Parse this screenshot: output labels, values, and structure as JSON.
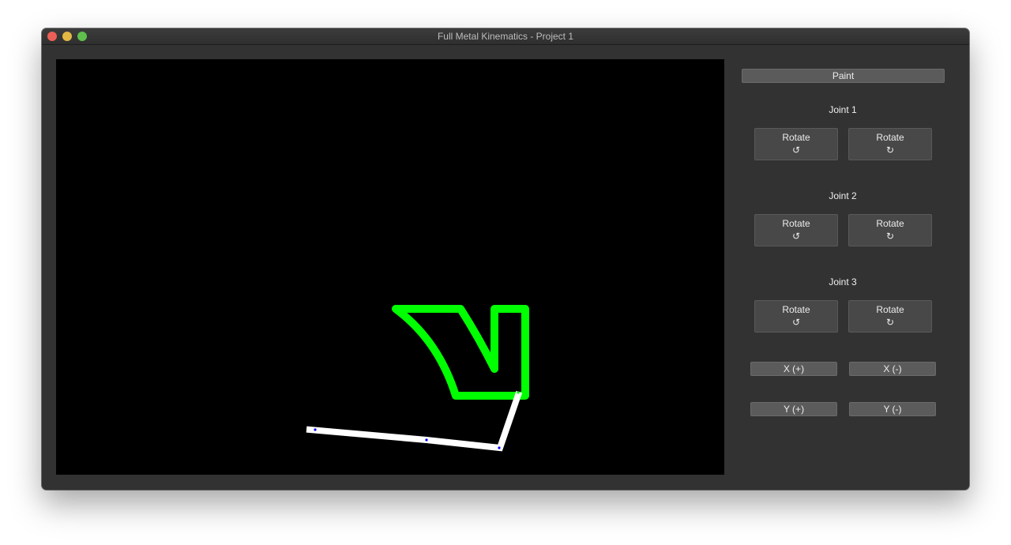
{
  "window": {
    "title": "Full Metal Kinematics - Project 1"
  },
  "panel": {
    "paint_label": "Paint",
    "joints": [
      {
        "label": "Joint 1",
        "ccw_label": "Rotate",
        "cw_label": "Rotate"
      },
      {
        "label": "Joint 2",
        "ccw_label": "Rotate",
        "cw_label": "Rotate"
      },
      {
        "label": "Joint 3",
        "ccw_label": "Rotate",
        "cw_label": "Rotate"
      }
    ],
    "icons": {
      "ccw": "↺",
      "cw": "↻",
      "ccw_name": "rotate-ccw-icon",
      "cw_name": "rotate-cw-icon"
    },
    "x_plus": "X (+)",
    "x_minus": "X (-)",
    "y_plus": "Y (+)",
    "y_minus": "Y (-)"
  },
  "canvas": {
    "background": "#000000",
    "paint_color": "#00ff00",
    "arm_color": "#ffffff",
    "joint_color": "#0000ff"
  }
}
